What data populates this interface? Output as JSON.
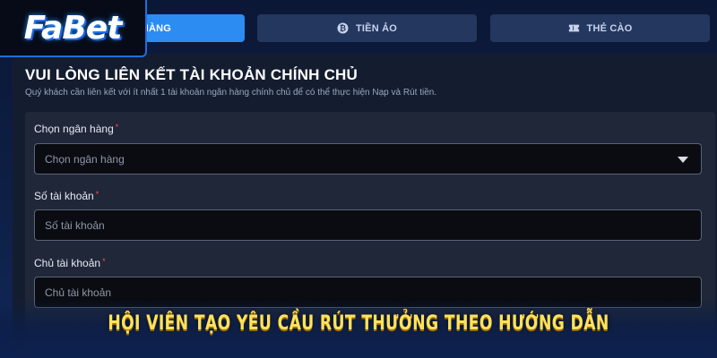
{
  "brand": {
    "logo_text": "FaBet"
  },
  "tabs": [
    {
      "label": "HÀNG",
      "icon": "bank-icon",
      "active": true
    },
    {
      "label": "TIỀN ẢO",
      "icon": "bitcoin-icon",
      "active": false
    },
    {
      "label": "THẺ CÀO",
      "icon": "ticket-icon",
      "active": false
    }
  ],
  "form": {
    "title": "VUI LÒNG LIÊN KẾT TÀI KHOẢN CHÍNH CHỦ",
    "subtitle": "Quý khách cần liên kết với ít nhất 1 tài khoản ngân hàng chính chủ để có thể thực hiện Nạp và Rút tiền.",
    "required_mark": "*",
    "fields": [
      {
        "label": "Chọn ngân hàng",
        "placeholder": "Chọn ngân hàng",
        "type": "select"
      },
      {
        "label": "Số tài khoản",
        "placeholder": "Số tài khoản",
        "type": "text"
      },
      {
        "label": "Chủ tài khoản",
        "placeholder": "Chủ tài khoản",
        "type": "text"
      }
    ]
  },
  "banner": {
    "caption": "HỘI VIÊN TẠO YÊU CẦU RÚT THƯỞNG THEO HƯỚNG DẪN"
  },
  "colors": {
    "accent": "#2c8cf2",
    "banner_text": "#ffe35c",
    "required": "#ff4d4f"
  }
}
